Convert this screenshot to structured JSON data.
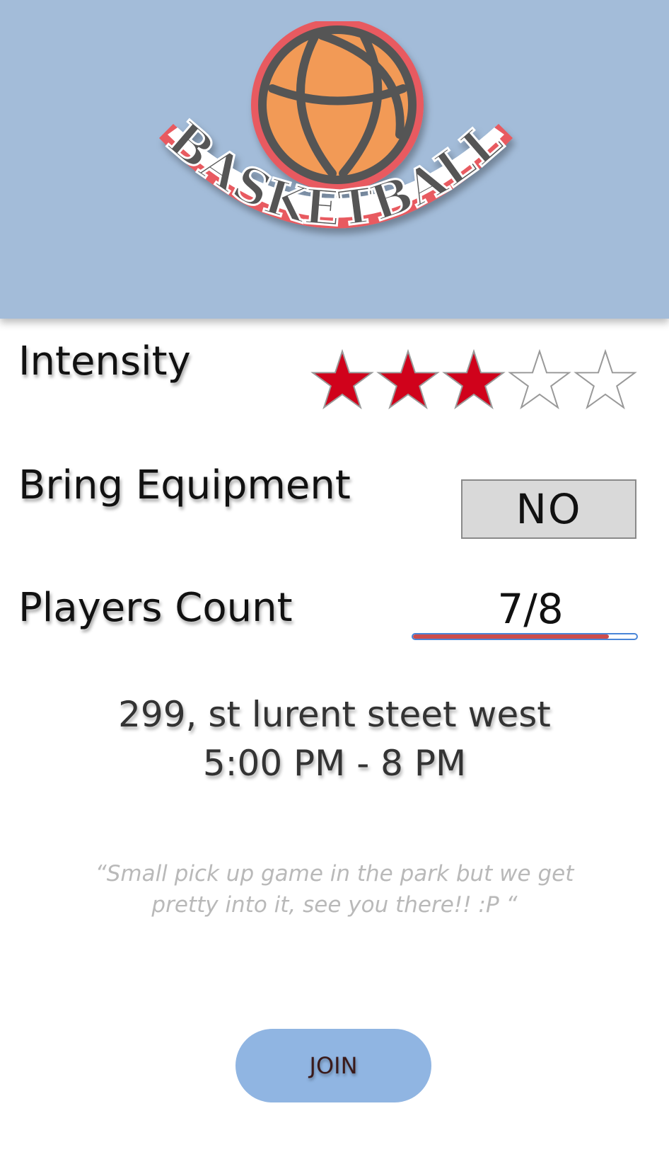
{
  "header": {
    "logo_text": "BASKETBALL",
    "background_color": "#a3bcd9",
    "icon": "basketball-icon"
  },
  "intensity": {
    "label": "Intensity",
    "rating": 3,
    "max": 5,
    "filled_color": "#d0021b",
    "empty_color": "#ffffff"
  },
  "equipment": {
    "label": "Bring Equipment",
    "value": "NO"
  },
  "players": {
    "label": "Players Count",
    "count_text": "7/8",
    "current": 7,
    "max": 8,
    "fill_color": "#cc4d4d",
    "track_color": "#4a86d8"
  },
  "location": {
    "address": "299, st lurent steet west",
    "time": "5:00 PM - 8 PM"
  },
  "description": "“Small pick up game in the park but we get pretty into it, see you there!! :P “",
  "join_button": {
    "label": "JOIN",
    "color": "#90b5e2"
  }
}
